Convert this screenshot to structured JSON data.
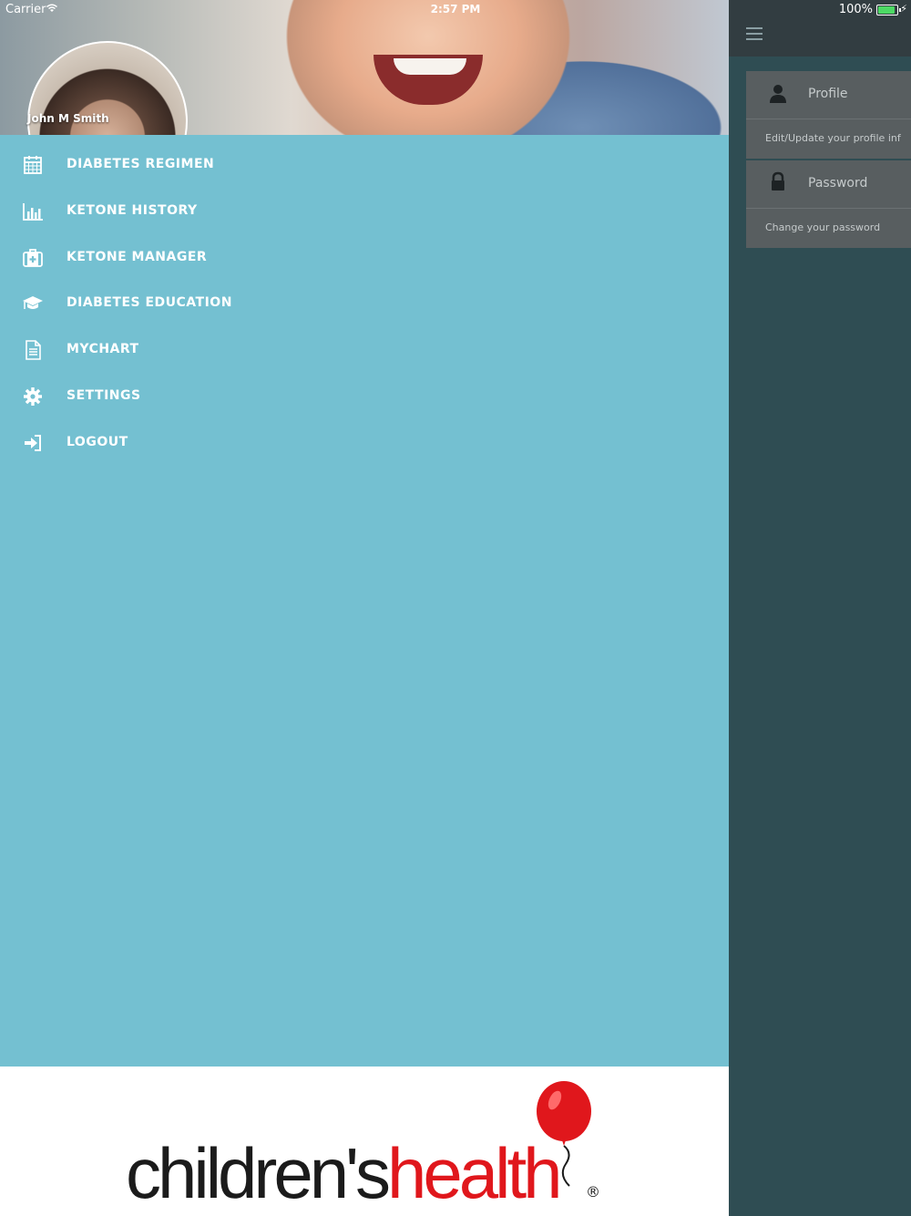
{
  "status_bar": {
    "carrier": "Carrier",
    "time": "2:57 PM",
    "battery_percent": "100%"
  },
  "drawer": {
    "user_name": "John M Smith",
    "menu": [
      {
        "label": "DIABETES REGIMEN",
        "icon": "calendar-icon"
      },
      {
        "label": "KETONE HISTORY",
        "icon": "bar-chart-icon"
      },
      {
        "label": "KETONE MANAGER",
        "icon": "medical-kit-icon"
      },
      {
        "label": "DIABETES EDUCATION",
        "icon": "graduation-cap-icon"
      },
      {
        "label": "MYCHART",
        "icon": "document-icon"
      },
      {
        "label": "SETTINGS",
        "icon": "gear-icon"
      },
      {
        "label": "LOGOUT",
        "icon": "sign-in-arrow-icon"
      }
    ],
    "footer_logo": {
      "part1": "children's",
      "part2": "health",
      "registered": "®"
    }
  },
  "background_panel": {
    "cards": [
      {
        "title": "Profile",
        "subtitle": "Edit/Update your profile inf",
        "icon": "user-icon"
      },
      {
        "title": "Password",
        "subtitle": "Change your password",
        "icon": "lock-icon"
      }
    ]
  },
  "colors": {
    "drawer_bg": "#74c0d1",
    "right_bg": "#2f4d53",
    "logo_red": "#e0171c"
  }
}
